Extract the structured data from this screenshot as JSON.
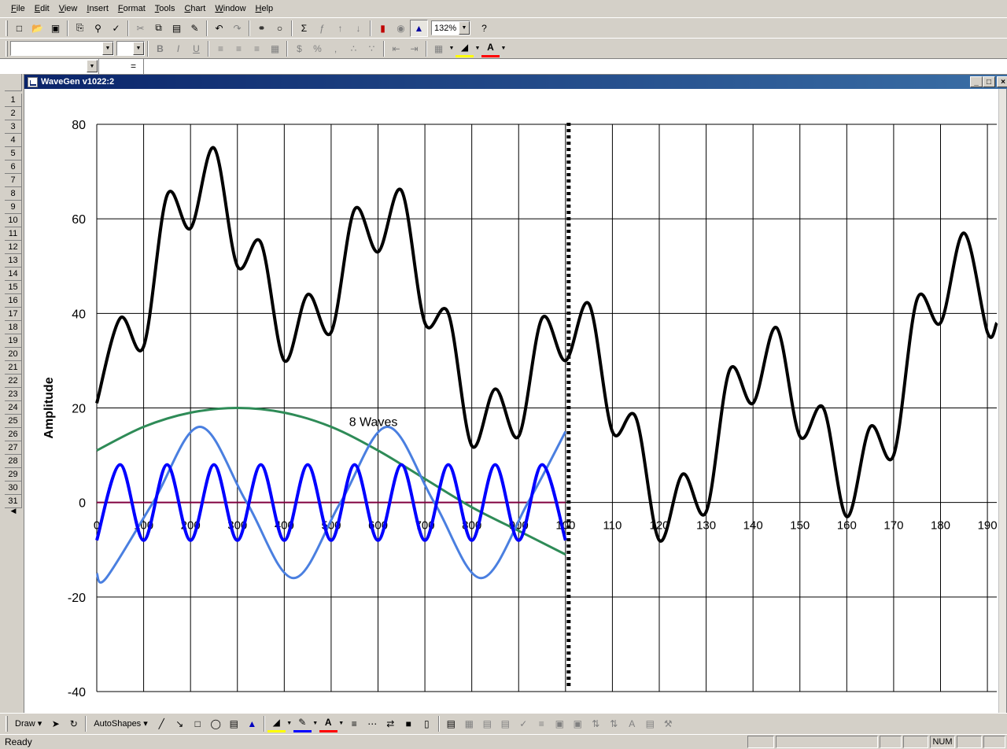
{
  "menubar": {
    "items": [
      "File",
      "Edit",
      "View",
      "Insert",
      "Format",
      "Tools",
      "Chart",
      "Window",
      "Help"
    ]
  },
  "toolbar": {
    "zoom_value": "132%"
  },
  "formatting": {
    "bold": "B",
    "italic": "I",
    "underline": "U",
    "currency": "$",
    "percent": "%",
    "comma": ",",
    "font_color_label": "A"
  },
  "formula_bar": {
    "name_box": "",
    "equals": "="
  },
  "rows": [
    "1",
    "2",
    "3",
    "4",
    "5",
    "6",
    "7",
    "8",
    "9",
    "10",
    "11",
    "12",
    "13",
    "14",
    "15",
    "16",
    "17",
    "18",
    "19",
    "20",
    "21",
    "22",
    "23",
    "24",
    "25",
    "26",
    "27",
    "28",
    "29",
    "30",
    "31"
  ],
  "window": {
    "title": "WaveGen v1022:2"
  },
  "chart_data": {
    "type": "line",
    "ylabel": "Amplitude",
    "annotation": "8 Waves",
    "ylim": [
      -40,
      80
    ],
    "y_ticks": [
      "80",
      "60",
      "40",
      "20",
      "0",
      "-20",
      "-40"
    ],
    "x_ticks_left": [
      "0",
      "100",
      "200",
      "300",
      "400",
      "500",
      "600",
      "700",
      "800",
      "900",
      "100"
    ],
    "x_ticks_right": [
      "110",
      "120",
      "130",
      "140",
      "150",
      "160",
      "170",
      "180",
      "190"
    ],
    "series": [
      {
        "color": "#000000",
        "x": [
          0,
          5,
          10,
          15,
          20,
          25,
          30,
          35,
          40,
          45,
          50,
          55,
          60,
          65,
          70,
          75,
          80,
          85,
          90,
          95,
          100,
          105,
          110,
          115,
          120,
          125,
          130,
          135,
          140,
          145,
          150,
          155,
          160,
          165,
          170,
          175,
          180,
          185,
          190,
          192
        ],
        "y": [
          21,
          39,
          33,
          65,
          58,
          75,
          50,
          55,
          30,
          44,
          36,
          62,
          53,
          66,
          38,
          40,
          12,
          24,
          14,
          39,
          30,
          42,
          15,
          18,
          -8,
          6,
          -2,
          28,
          21,
          37,
          14,
          20,
          -3,
          16,
          10,
          43,
          38,
          57,
          36,
          38
        ]
      },
      {
        "color": "#2e8b57",
        "x": [
          0,
          10,
          20,
          30,
          40,
          50,
          60,
          70,
          80,
          90,
          100
        ],
        "y": [
          11,
          16,
          19,
          20,
          19,
          16,
          11,
          5,
          -1,
          -6,
          -11
        ]
      },
      {
        "color": "#4a7fe0",
        "x": [
          0,
          2,
          12,
          22,
          32,
          42,
          52,
          62,
          72,
          82,
          92,
          100
        ],
        "y": [
          -15,
          -16,
          0,
          16,
          0,
          -16,
          0,
          16,
          0,
          -16,
          0,
          15
        ]
      },
      {
        "color": "#0000ff",
        "x": [
          0,
          5,
          10,
          15,
          20,
          25,
          30,
          35,
          40,
          45,
          50,
          55,
          60,
          65,
          70,
          75,
          80,
          85,
          90,
          95,
          100
        ],
        "y": [
          -8,
          8,
          -8,
          8,
          -8,
          8,
          -8,
          8,
          -8,
          8,
          -8,
          8,
          -8,
          8,
          -8,
          8,
          -8,
          8,
          -8,
          8,
          -8
        ]
      },
      {
        "color": "#800040",
        "x": [
          0,
          100
        ],
        "y": [
          0,
          0
        ]
      }
    ]
  },
  "drawing": {
    "draw_label": "Draw",
    "autoshapes_label": "AutoShapes"
  },
  "status": {
    "ready": "Ready",
    "num": "NUM"
  }
}
